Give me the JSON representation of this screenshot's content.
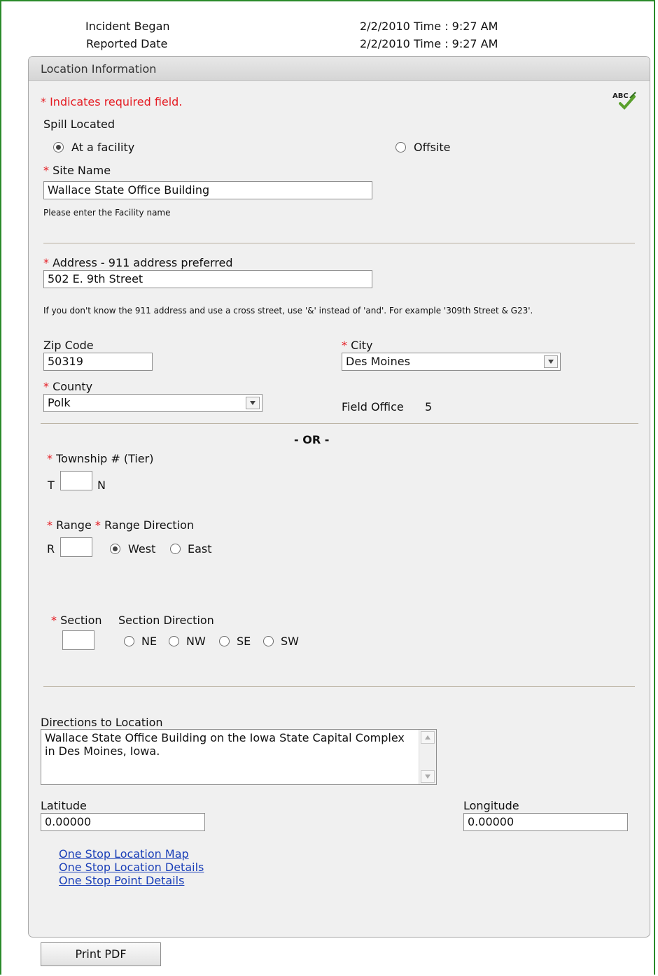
{
  "header": {
    "incident_began_label": "Incident Began",
    "incident_began_value": "2/2/2010 Time : 9:27 AM",
    "reported_date_label": "Reported Date",
    "reported_date_value": "2/2/2010 Time : 9:27 AM"
  },
  "panel": {
    "title": "Location Information",
    "required_note": "* Indicates required field.",
    "spellcheck_icon_text": "ABC"
  },
  "spill": {
    "label": "Spill Located",
    "options": [
      {
        "label": "At a facility",
        "selected": true
      },
      {
        "label": "Offsite",
        "selected": false
      }
    ]
  },
  "site": {
    "label": "Site Name",
    "value": "Wallace State Office Building",
    "hint": "Please enter the Facility name"
  },
  "address": {
    "label": "Address - 911 address preferred",
    "value": "502 E. 9th Street",
    "hint": "If you don't know the 911 address and use a cross street, use '&' instead of 'and'. For example '309th Street & G23'."
  },
  "zip": {
    "label": "Zip Code",
    "value": "50319"
  },
  "city": {
    "label": "City",
    "value": "Des Moines"
  },
  "county": {
    "label": "County",
    "value": "Polk"
  },
  "field_office": {
    "label": "Field Office",
    "value": "5"
  },
  "or_label": "- OR -",
  "township": {
    "label": "Township # (Tier)",
    "prefix": "T",
    "suffix": "N",
    "value": ""
  },
  "range": {
    "label": "Range",
    "direction_label": "Range Direction",
    "prefix": "R",
    "value": "",
    "options": [
      {
        "label": "West",
        "selected": true
      },
      {
        "label": "East",
        "selected": false
      }
    ]
  },
  "section": {
    "label": "Section",
    "direction_label": "Section Direction",
    "value": "",
    "options": [
      {
        "label": "NE",
        "selected": false
      },
      {
        "label": "NW",
        "selected": false
      },
      {
        "label": "SE",
        "selected": false
      },
      {
        "label": "SW",
        "selected": false
      }
    ]
  },
  "directions": {
    "label": "Directions to Location",
    "value": "Wallace State Office Building on the Iowa State Capital Complex in Des Moines, Iowa."
  },
  "latitude": {
    "label": "Latitude",
    "value": "0.00000"
  },
  "longitude": {
    "label": "Longitude",
    "value": "0.00000"
  },
  "links": [
    "One Stop Location Map",
    "One Stop Location Details",
    "One Stop Point Details"
  ],
  "print_button": "Print PDF",
  "colors": {
    "frame": "#2a8a2a",
    "required": "#e51c23",
    "link": "#1a3fb8"
  }
}
